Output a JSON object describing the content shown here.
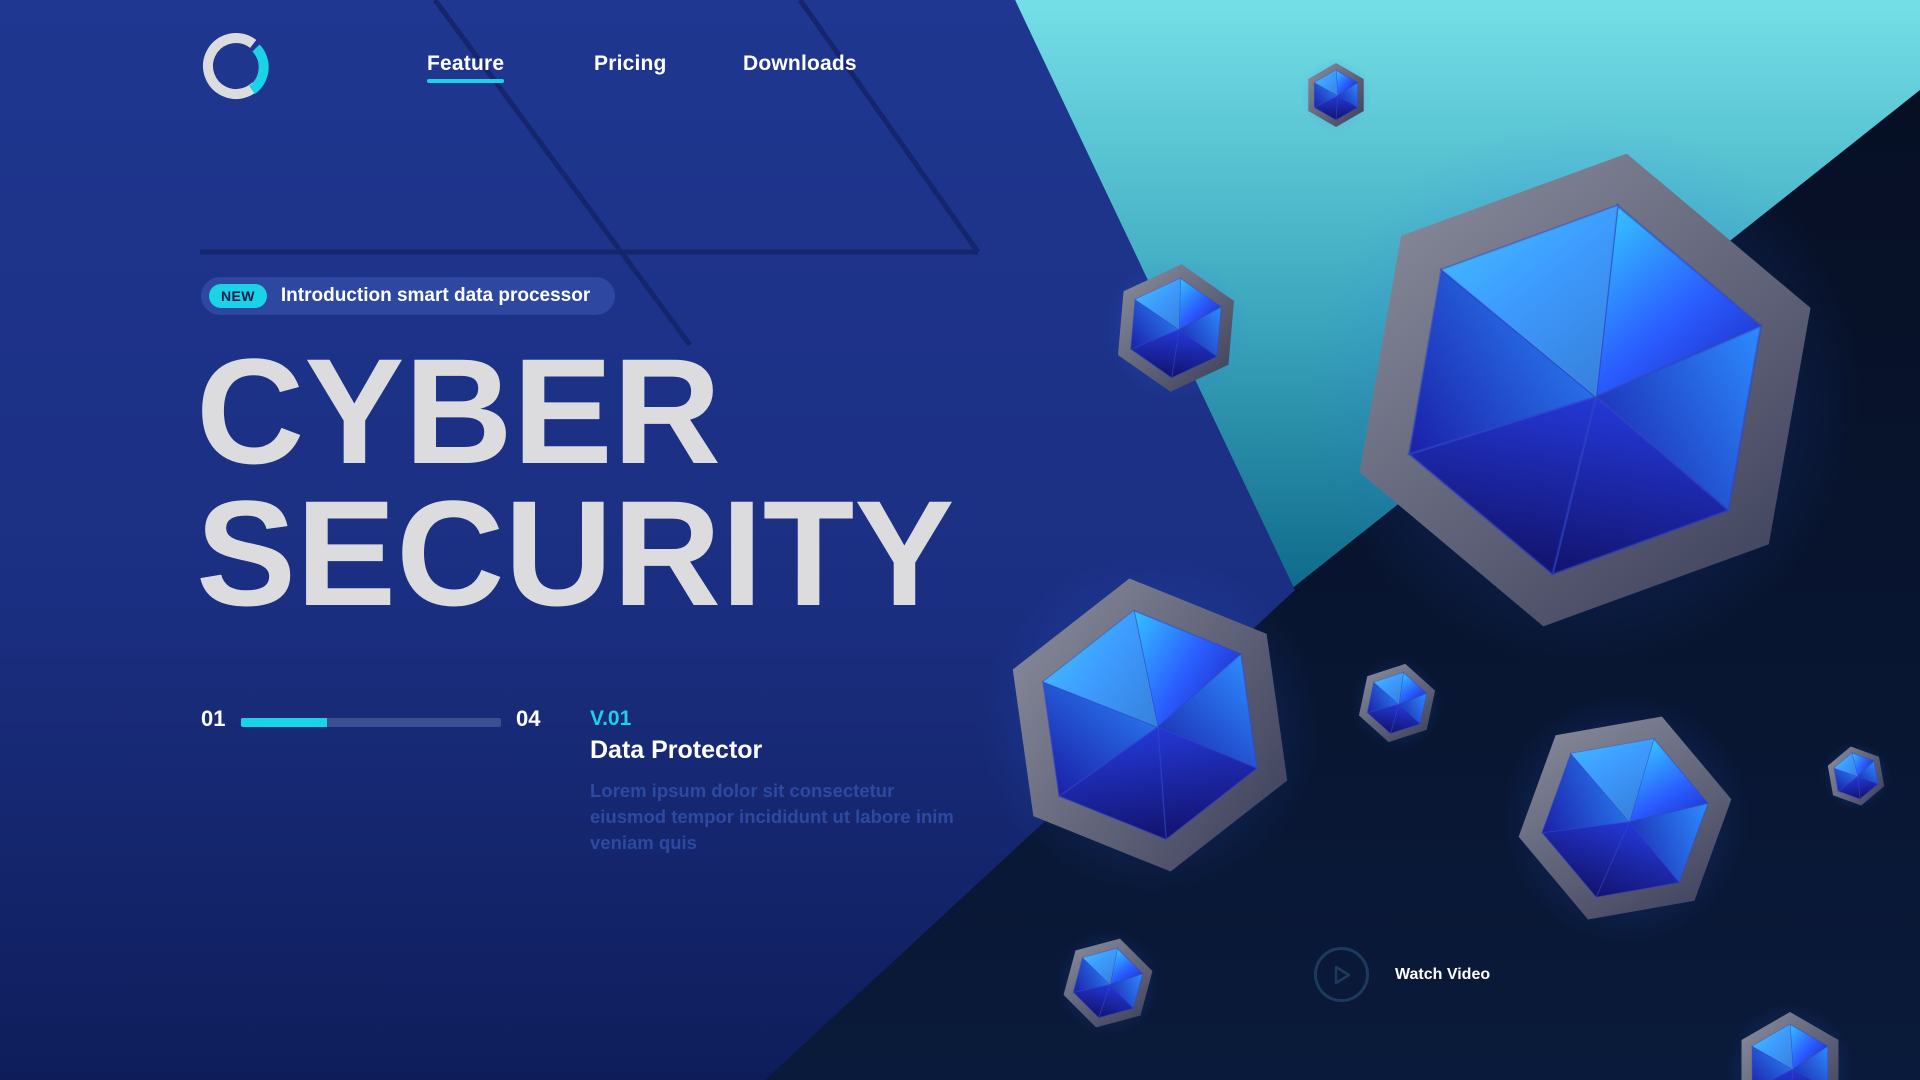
{
  "brand": {
    "logo_icon": "ring-logo-icon",
    "accent": "#1bd3e6"
  },
  "nav": {
    "items": [
      {
        "label": "Feature",
        "active": true
      },
      {
        "label": "Pricing",
        "active": false
      },
      {
        "label": "Downloads",
        "active": false
      }
    ]
  },
  "badge": {
    "tag": "NEW",
    "text": "Introduction smart data processor"
  },
  "hero": {
    "line1": "CYBER",
    "line2": "SECURITY"
  },
  "slider": {
    "current": "01",
    "total": "04",
    "progress": 0.33
  },
  "feature": {
    "version": "V.01",
    "title": "Data Protector",
    "body": "Lorem ipsum dolor sit consectetur eiusmod tempor incididunt ut labore inim veniam quis"
  },
  "video": {
    "label": "Watch Video",
    "icon": "play-icon"
  },
  "colors": {
    "background_left": "#1e3588",
    "background_teal": "#6fdbe4",
    "background_dark": "#081530",
    "headline": "#dcdcde",
    "gem_blue": "#2a5dff"
  }
}
